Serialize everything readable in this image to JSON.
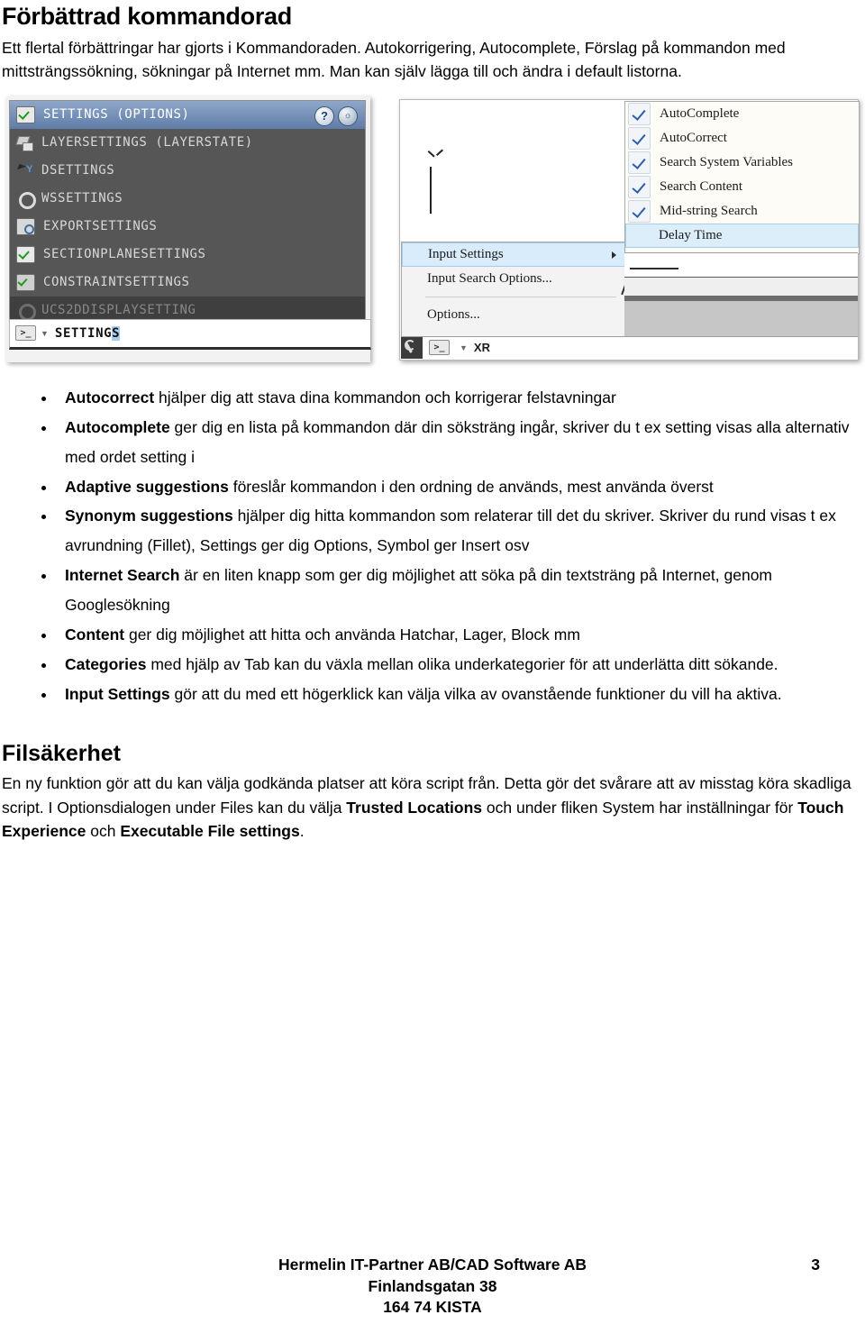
{
  "document": {
    "heading": "Förbättrad kommandorad",
    "intro": "Ett flertal förbättringar har gjorts i Kommandoraden. Autokorrigering, Autocomplete, Förslag på kommandon med mittsträngssökning, sökningar på Internet mm. Man kan själv lägga till och ändra i default listorna."
  },
  "figure_left": {
    "caption_name": "command-line-suggestion-list",
    "help_buttons": [
      {
        "name": "help-question-icon",
        "glyph": "?"
      },
      {
        "name": "help-search-globe-icon",
        "glyph": "ⓘ"
      }
    ],
    "rows": [
      {
        "label": "SETTINGS (OPTIONS)",
        "icon": "checkbox-green-icon",
        "state": "selected"
      },
      {
        "label": "LAYERSETTINGS (LAYERSTATE)",
        "icon": "layers-icon",
        "state": "normal"
      },
      {
        "label": "DSETTINGS",
        "icon": "drafting-settings-icon",
        "state": "normal"
      },
      {
        "label": "WSSETTINGS",
        "icon": "gear-icon",
        "state": "normal"
      },
      {
        "label": "EXPORTSETTINGS",
        "icon": "export-icon",
        "state": "normal"
      },
      {
        "label": "SECTIONPLANESETTINGS",
        "icon": "checkbox-green-icon",
        "state": "normal"
      },
      {
        "label": "CONSTRAINTSETTINGS",
        "icon": "constraint-icon",
        "state": "normal"
      },
      {
        "label": "UCS2DDISPLAYSETTING",
        "icon": "gear-dim-icon",
        "state": "dimmed"
      }
    ],
    "input": {
      "prompt_glyph": ">_",
      "typed_prefix": "SETTING",
      "typed_selected": "S"
    }
  },
  "figure_right": {
    "caption_name": "input-settings-context-menu",
    "context_menu": [
      {
        "label": "Input Settings",
        "has_submenu": true,
        "highlighted": true
      },
      {
        "label": "Input Search Options...",
        "has_submenu": false,
        "highlighted": false
      },
      {
        "label": "Options...",
        "has_submenu": false,
        "highlighted": false
      }
    ],
    "submenu": [
      {
        "label": "AutoComplete",
        "checked": true,
        "highlighted": false
      },
      {
        "label": "AutoCorrect",
        "checked": true,
        "highlighted": false
      },
      {
        "label": "Search System Variables",
        "checked": true,
        "highlighted": false
      },
      {
        "label": "Search Content",
        "checked": true,
        "highlighted": false
      },
      {
        "label": "Mid-string Search",
        "checked": true,
        "highlighted": false
      },
      {
        "label": "Delay Time",
        "checked": false,
        "highlighted": true
      }
    ],
    "command_bar": {
      "prompt_glyph": ">_",
      "text": "XR"
    },
    "ucs_axis_label": "Y"
  },
  "bullets": [
    {
      "term": "Autocorrect",
      "rest": " hjälper dig att stava dina kommandon och korrigerar felstavningar"
    },
    {
      "term": "Autocomplete",
      "rest": " ger dig en lista på kommandon där din söksträng ingår, skriver du t ex setting visas alla alternativ med ordet setting i"
    },
    {
      "term": "Adaptive suggestions",
      "rest": " föreslår kommandon i den ordning de används, mest använda överst"
    },
    {
      "term": "Synonym suggestions",
      "rest": " hjälper dig hitta kommandon som relaterar till det du skriver. Skriver du rund visas t ex avrundning (Fillet), Settings ger dig Options, Symbol ger Insert osv"
    },
    {
      "term": "Internet Search",
      "rest": " är en liten knapp som ger dig möjlighet att söka på din textsträng på Internet, genom Googlesökning"
    },
    {
      "term": "Content",
      "rest": " ger dig möjlighet att hitta och använda Hatchar, Lager, Block mm"
    },
    {
      "term": "Categories",
      "rest": " med hjälp av Tab kan du växla mellan olika underkategorier för att underlätta ditt sökande."
    },
    {
      "term": "Input Settings",
      "rest": " gör att du med ett högerklick kan välja vilka av ovanstående funktioner du vill ha aktiva."
    }
  ],
  "section2": {
    "heading": "Filsäkerhet",
    "part1": "En ny funktion gör att du kan välja godkända platser att köra script från. Detta gör det svårare att av misstag köra skadliga script. I Optionsdialogen under Files kan du välja ",
    "bold1": "Trusted Locations",
    "part2": " och under fliken System har inställningar för ",
    "bold2": "Touch Experience",
    "part3": " och ",
    "bold3": "Executable File settings",
    "part4": "."
  },
  "footer": {
    "line1": "Hermelin IT-Partner AB/CAD Software AB",
    "line2": "Finlandsgatan 38",
    "line3": "164 74 KISTA",
    "page_number": "3"
  }
}
